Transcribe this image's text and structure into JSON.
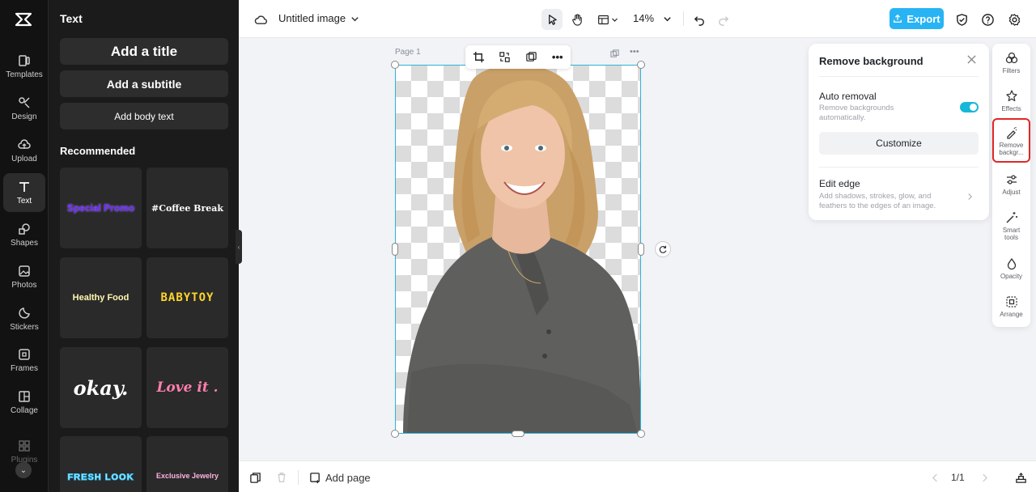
{
  "rail": {
    "items": [
      {
        "label": "Templates",
        "icon": "templates-icon"
      },
      {
        "label": "Design",
        "icon": "design-icon"
      },
      {
        "label": "Upload",
        "icon": "upload-icon"
      },
      {
        "label": "Text",
        "icon": "text-icon"
      },
      {
        "label": "Shapes",
        "icon": "shapes-icon"
      },
      {
        "label": "Photos",
        "icon": "photos-icon"
      },
      {
        "label": "Stickers",
        "icon": "stickers-icon"
      },
      {
        "label": "Frames",
        "icon": "frames-icon"
      },
      {
        "label": "Collage",
        "icon": "collage-icon"
      },
      {
        "label": "Plugins",
        "icon": "plugins-icon"
      }
    ]
  },
  "panel": {
    "title": "Text",
    "add_title": "Add a title",
    "add_subtitle": "Add a subtitle",
    "add_body": "Add body text",
    "recommended": "Recommended",
    "tiles": [
      "Special Promo",
      "#Coffee Break",
      "Healthy Food",
      "BABYTOY",
      "okay.",
      "Love it .",
      "FRESH LOOK",
      "Exclusive Jewelry"
    ]
  },
  "topbar": {
    "doc_title": "Untitled image",
    "zoom": "14%",
    "export_label": "Export"
  },
  "canvas": {
    "page_label": "Page 1"
  },
  "remove_bg": {
    "title": "Remove background",
    "auto_title": "Auto removal",
    "auto_desc": "Remove backgrounds automatically.",
    "auto_enabled": true,
    "customize_label": "Customize",
    "edge_title": "Edit edge",
    "edge_desc": "Add shadows, strokes, glow, and feathers to the edges of an image."
  },
  "tools": [
    {
      "label": "Filters"
    },
    {
      "label": "Effects"
    },
    {
      "label": "Remove backgr..."
    },
    {
      "label": "Adjust"
    },
    {
      "label": "Smart tools"
    },
    {
      "label": "Opacity"
    },
    {
      "label": "Arrange"
    }
  ],
  "bottombar": {
    "add_page": "Add page",
    "page_count": "1/1"
  },
  "colors": {
    "accent": "#28b4f4",
    "selection": "#2fb3d8",
    "toggle_on": "#17b8d7",
    "highlight": "#e02727"
  }
}
